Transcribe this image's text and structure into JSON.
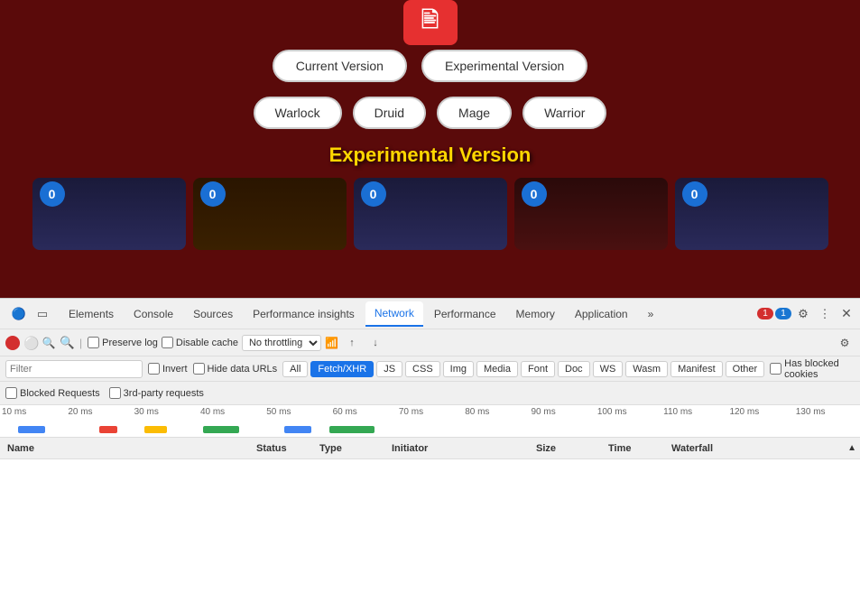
{
  "app": {
    "logo_symbol": "⌐",
    "version_buttons": [
      {
        "label": "Current Version",
        "active": false
      },
      {
        "label": "Experimental Version",
        "active": false
      }
    ],
    "class_buttons": [
      {
        "label": "Warlock"
      },
      {
        "label": "Druid"
      },
      {
        "label": "Mage"
      },
      {
        "label": "Warrior"
      }
    ],
    "section_title": "Experimental Version"
  },
  "devtools": {
    "tabs": [
      {
        "label": "Elements",
        "active": false
      },
      {
        "label": "Console",
        "active": false
      },
      {
        "label": "Sources",
        "active": false
      },
      {
        "label": "Performance insights",
        "active": false,
        "has_icon": true
      },
      {
        "label": "Network",
        "active": true
      },
      {
        "label": "Performance",
        "active": false
      },
      {
        "label": "Memory",
        "active": false
      },
      {
        "label": "Application",
        "active": false
      },
      {
        "label": "»",
        "active": false
      }
    ],
    "badges": {
      "red": "1",
      "blue": "1"
    },
    "network": {
      "preserve_log_label": "Preserve log",
      "disable_cache_label": "Disable cache",
      "throttle_label": "No throttling",
      "filter_placeholder": "Filter",
      "invert_label": "Invert",
      "hide_data_urls_label": "Hide data URLs",
      "all_label": "All",
      "filter_types": [
        "Fetch/XHR",
        "JS",
        "CSS",
        "Img",
        "Media",
        "Font",
        "Doc",
        "WS",
        "Wasm",
        "Manifest",
        "Other"
      ],
      "active_filter": "Fetch/XHR",
      "has_blocked_label": "Has blocked cookies",
      "blocked_requests_label": "Blocked Requests",
      "third_party_label": "3rd-party requests"
    },
    "timeline": {
      "labels": [
        "10 ms",
        "20 ms",
        "30 ms",
        "40 ms",
        "50 ms",
        "60 ms",
        "70 ms",
        "80 ms",
        "90 ms",
        "100 ms",
        "110 ms",
        "120 ms",
        "130 ms"
      ]
    },
    "table": {
      "columns": [
        "Name",
        "Status",
        "Type",
        "Initiator",
        "Size",
        "Time",
        "Waterfall"
      ]
    }
  }
}
